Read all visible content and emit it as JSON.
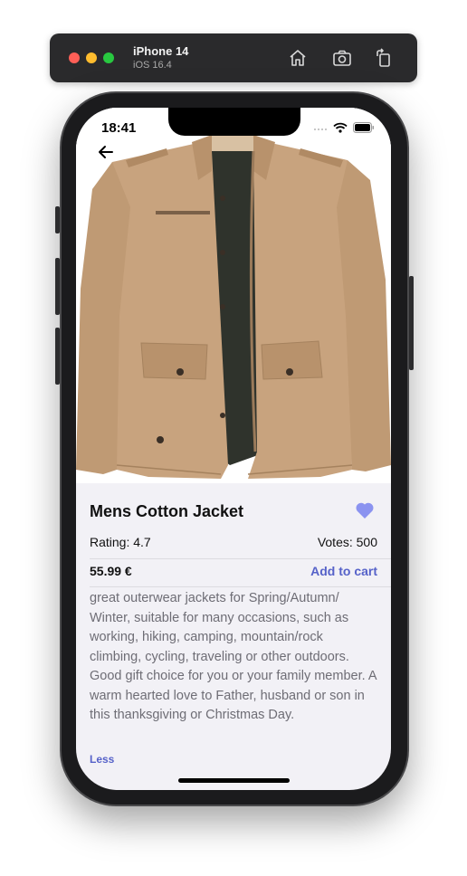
{
  "simulator": {
    "device": "iPhone 14",
    "os": "iOS 16.4",
    "icons": [
      "home-icon",
      "screenshot-icon",
      "rotate-icon"
    ]
  },
  "status_bar": {
    "time": "18:41"
  },
  "product": {
    "title": "Mens Cotton Jacket",
    "rating_text": "Rating: 4.7",
    "votes_text": "Votes: 500",
    "price": "55.99 €",
    "add_to_cart": "Add to cart",
    "description": "great outerwear jackets for Spring/Autumn/ Winter, suitable for many occasions, such as working, hiking, camping, mountain/rock climbing, cycling, traveling or other outdoors. Good gift choice for you or your family member. A warm hearted love to Father, husband or son in this thanksgiving or Christmas Day.",
    "less_label": "Less",
    "favorite": true
  },
  "colors": {
    "accent": "#5662c9",
    "heart": "#8b93f0",
    "background": "#f2f1f6"
  }
}
